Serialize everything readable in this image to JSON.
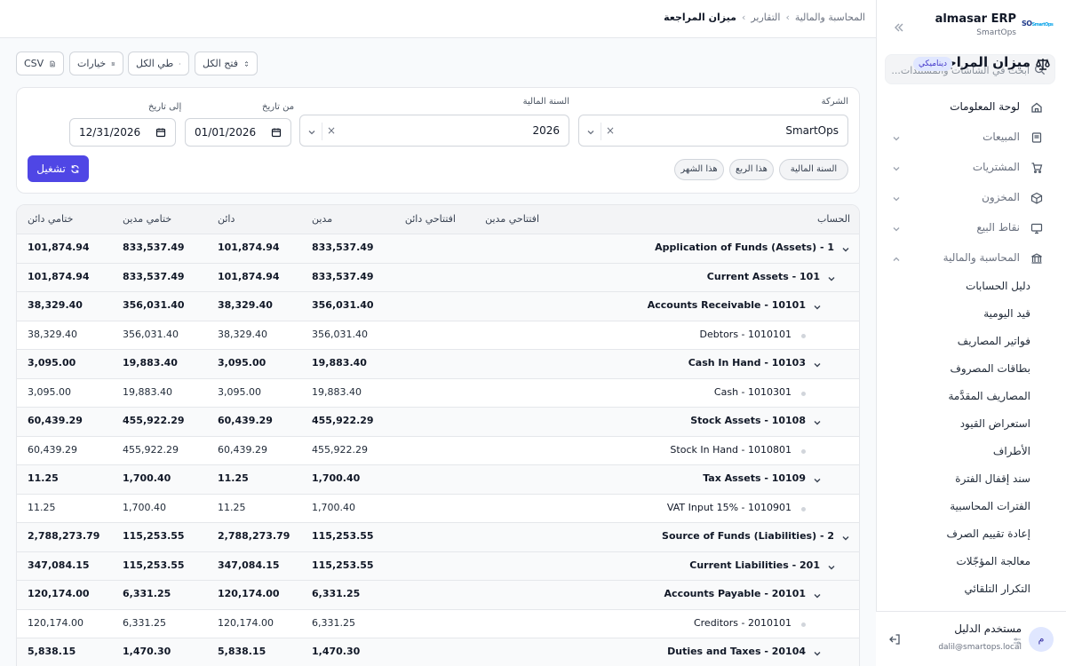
{
  "brand": {
    "logo_text": "SO",
    "logo_small": "SmartOps",
    "name": "almasar ERP",
    "subtitle": "SmartOps"
  },
  "search": {
    "placeholder": "ابحث في الشاشات والمستندات..."
  },
  "sidebar": {
    "items": [
      {
        "label": "لوحة المعلومات",
        "icon": "home-icon"
      },
      {
        "label": "المبيعات",
        "icon": "receipt-icon"
      },
      {
        "label": "المشتريات",
        "icon": "cart-icon"
      },
      {
        "label": "المخزون",
        "icon": "box-icon"
      },
      {
        "label": "نقاط البيع",
        "icon": "monitor-icon"
      },
      {
        "label": "المحاسبة والمالية",
        "icon": "bank-icon"
      }
    ],
    "accounting_sub": [
      "دليل الحسابات",
      "قيد اليومية",
      "فواتير المصاريف",
      "بطاقات المصروف",
      "المصاريف المقدَّمة",
      "استعراض القيود",
      "الأطراف",
      "سند إقفال الفترة",
      "الفترات المحاسبية",
      "إعادة تقييم الصرف",
      "معالجة المؤجّلات",
      "التكرار التلقائي"
    ]
  },
  "user": {
    "initial": "م",
    "name": "مستخدم الدليل",
    "email": "dalil@smartops.local"
  },
  "breadcrumb": {
    "level1": "المحاسبة والمالية",
    "level2": "التقارير",
    "current": "ميزان المراجعة",
    "separator": "›"
  },
  "page": {
    "title": "ميزان المراجعة",
    "badge": "ديناميكي"
  },
  "toolbar": {
    "expand_all": "فتح الكل",
    "collapse_all": "طي الكل",
    "options": "خيارات",
    "csv": "CSV"
  },
  "filters": {
    "company_label": "الشركة",
    "company_value": "SmartOps",
    "fiscal_year_label": "السنة المالية",
    "fiscal_year_value": "2026",
    "from_label": "من تاريخ",
    "from_value": "01/01/2026",
    "to_label": "إلى تاريخ",
    "to_value": "12/31/2026",
    "clear_symbol": "×",
    "presets": [
      "السنة المالية",
      "هذا الربع",
      "هذا الشهر"
    ],
    "run_label": "تشغيل"
  },
  "table": {
    "headers": {
      "account": "الحساب",
      "opening_debit": "افتتاحي مدين",
      "opening_credit": "افتتاحي دائن",
      "debit": "مدين",
      "credit": "دائن",
      "closing_debit": "ختامي مدين",
      "closing_credit": "ختامي دائن"
    },
    "rows": [
      {
        "account": "Application of Funds (Assets) - 1",
        "level": 0,
        "group": true,
        "debit": "833,537.49",
        "credit": "101,874.94",
        "closing_debit": "833,537.49",
        "closing_credit": "101,874.94"
      },
      {
        "account": "Current Assets - 101",
        "level": 1,
        "group": true,
        "debit": "833,537.49",
        "credit": "101,874.94",
        "closing_debit": "833,537.49",
        "closing_credit": "101,874.94"
      },
      {
        "account": "Accounts Receivable - 10101",
        "level": 2,
        "group": true,
        "debit": "356,031.40",
        "credit": "38,329.40",
        "closing_debit": "356,031.40",
        "closing_credit": "38,329.40"
      },
      {
        "account": "Debtors - 1010101",
        "level": 3,
        "group": false,
        "debit": "356,031.40",
        "credit": "38,329.40",
        "closing_debit": "356,031.40",
        "closing_credit": "38,329.40"
      },
      {
        "account": "Cash In Hand - 10103",
        "level": 2,
        "group": true,
        "debit": "19,883.40",
        "credit": "3,095.00",
        "closing_debit": "19,883.40",
        "closing_credit": "3,095.00"
      },
      {
        "account": "Cash - 1010301",
        "level": 3,
        "group": false,
        "debit": "19,883.40",
        "credit": "3,095.00",
        "closing_debit": "19,883.40",
        "closing_credit": "3,095.00"
      },
      {
        "account": "Stock Assets - 10108",
        "level": 2,
        "group": true,
        "debit": "455,922.29",
        "credit": "60,439.29",
        "closing_debit": "455,922.29",
        "closing_credit": "60,439.29"
      },
      {
        "account": "Stock In Hand - 1010801",
        "level": 3,
        "group": false,
        "debit": "455,922.29",
        "credit": "60,439.29",
        "closing_debit": "455,922.29",
        "closing_credit": "60,439.29"
      },
      {
        "account": "Tax Assets - 10109",
        "level": 2,
        "group": true,
        "debit": "1,700.40",
        "credit": "11.25",
        "closing_debit": "1,700.40",
        "closing_credit": "11.25"
      },
      {
        "account": "VAT Input 15% - 1010901",
        "level": 3,
        "group": false,
        "debit": "1,700.40",
        "credit": "11.25",
        "closing_debit": "1,700.40",
        "closing_credit": "11.25"
      },
      {
        "account": "Source of Funds (Liabilities) - 2",
        "level": 0,
        "group": true,
        "debit": "115,253.55",
        "credit": "2,788,273.79",
        "closing_debit": "115,253.55",
        "closing_credit": "2,788,273.79"
      },
      {
        "account": "Current Liabilities - 201",
        "level": 1,
        "group": true,
        "debit": "115,253.55",
        "credit": "347,084.15",
        "closing_debit": "115,253.55",
        "closing_credit": "347,084.15"
      },
      {
        "account": "Accounts Payable - 20101",
        "level": 2,
        "group": true,
        "debit": "6,331.25",
        "credit": "120,174.00",
        "closing_debit": "6,331.25",
        "closing_credit": "120,174.00"
      },
      {
        "account": "Creditors - 2010101",
        "level": 3,
        "group": false,
        "debit": "6,331.25",
        "credit": "120,174.00",
        "closing_debit": "6,331.25",
        "closing_credit": "120,174.00"
      },
      {
        "account": "Duties and Taxes - 20104",
        "level": 2,
        "group": true,
        "debit": "1,470.30",
        "credit": "5,838.15",
        "closing_debit": "1,470.30",
        "closing_credit": "5,838.15"
      }
    ]
  },
  "colors": {
    "accent": "#4f46e5",
    "badge_bg": "#e0e7ff",
    "group_row_bg": "#f9fafb"
  }
}
